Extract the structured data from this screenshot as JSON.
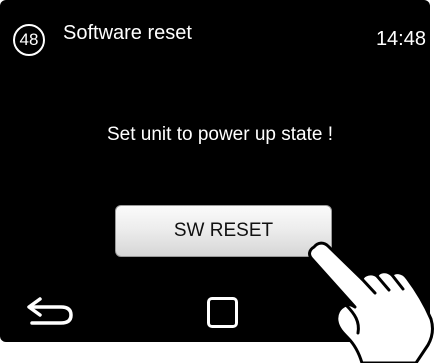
{
  "header": {
    "menu_number": "48",
    "title": "Software reset",
    "time": "14:48"
  },
  "main": {
    "message": "Set unit to power up state !",
    "reset_button_label": "SW RESET"
  },
  "nav": {
    "back_icon": "back-arrow-icon",
    "home_icon": "home-square-icon"
  },
  "overlay": {
    "pointer_icon": "pointing-hand-icon"
  },
  "colors": {
    "screen_background": "#000000",
    "text": "#ffffff",
    "button_face": "#e6e6e6",
    "button_text": "#111111"
  }
}
